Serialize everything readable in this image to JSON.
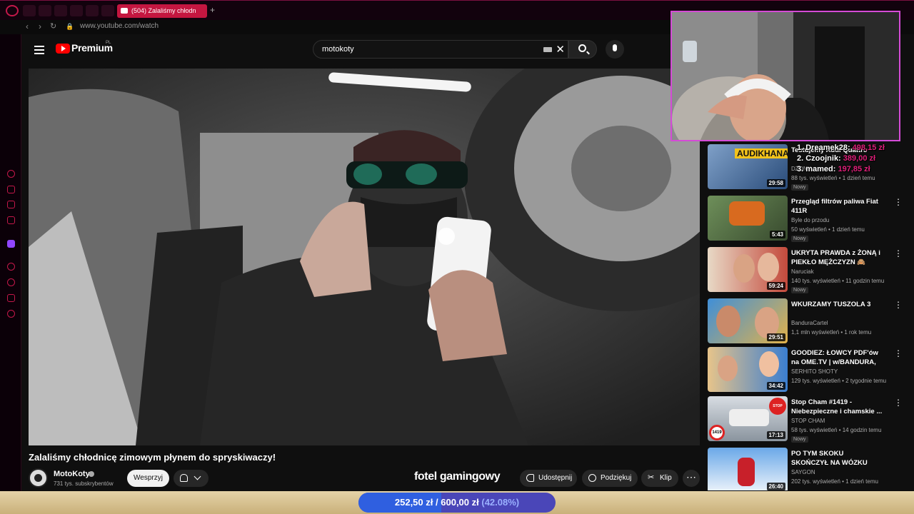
{
  "browser": {
    "active_tab_label": "(504) Zalaliśmy chłodn",
    "url": "www.youtube.com/watch"
  },
  "youtube": {
    "brand": "Premium",
    "brand_sup": "PL",
    "search_value": "motokoty"
  },
  "video": {
    "title": "Zalaliśmy chłodnicę zimowym płynem do spryskiwaczy!",
    "channel_name": "MotoKoty",
    "channel_subs": "731 tys. subskrybentów",
    "support_label": "Wesprzyj",
    "share_label": "Udostępnij",
    "thanks_label": "Podziękuj",
    "clip_label": "Klip",
    "overlay_brand": "fotel gamingowy"
  },
  "recommendations": [
    {
      "title": "Testujemy Audi Quattro",
      "channel": "DŻONY",
      "meta": "88 tys. wyświetleń • 1 dzień temu",
      "badge": "Nowy",
      "duration": "29:58"
    },
    {
      "title": "Przegląd filtrów paliwa Fiat 411R",
      "channel": "Byle do przodu",
      "meta": "50 wyświetleń • 1 dzień temu",
      "badge": "Nowy",
      "duration": "5:43"
    },
    {
      "title": "UKRYTA PRAWDA z ŻONĄ i PIEKŁO MĘŻCZYZN 🙈",
      "channel": "Naruciak",
      "meta": "140 tys. wyświetleń • 11 godzin temu",
      "badge": "Nowy",
      "duration": "59:24"
    },
    {
      "title": "WKURZAMY TUSZOLA 3",
      "channel": "BanduraCartel",
      "meta": "1,1 mln wyświetleń • 1 rok temu",
      "badge": "",
      "duration": "29:51"
    },
    {
      "title": "GOODIEZ: ŁOWCY PDF'ów na OME.TV | w/BANDURA, ...",
      "channel": "SERHITO SHOTY",
      "meta": "129 tys. wyświetleń • 2 tygodnie temu",
      "badge": "",
      "duration": "34:42"
    },
    {
      "title": "Stop Cham #1419 - Niebezpieczne i chamskie ...",
      "channel": "STOP CHAM",
      "meta": "58 tys. wyświetleń • 14 godzin temu",
      "badge": "Nowy",
      "duration": "17:13"
    },
    {
      "title": "PO TYM SKOKU SKOŃCZYŁ NA WÓZKU",
      "channel": "SAYGON",
      "meta": "202 tys. wyświetleń • 1 dzień temu",
      "badge": "",
      "duration": "26:40"
    }
  ],
  "leaderboard": [
    {
      "rank": "1. Dreamek28:",
      "amount": "498,15 zł"
    },
    {
      "rank": "2. Czoojnik:",
      "amount": "389,00 zł"
    },
    {
      "rank": "3. mamed:",
      "amount": "197,85 zł"
    }
  ],
  "donation_goal": {
    "current": "252,50 zł",
    "separator": "/",
    "target": "600,00 zł",
    "percent_label": "(42.08%)",
    "fraction": 0.4208
  },
  "colors": {
    "accent": "#c41640",
    "leader_amount": "#e0207a",
    "webcam_border": "#d44bd6",
    "goal_fill": "#2f5fe0"
  }
}
